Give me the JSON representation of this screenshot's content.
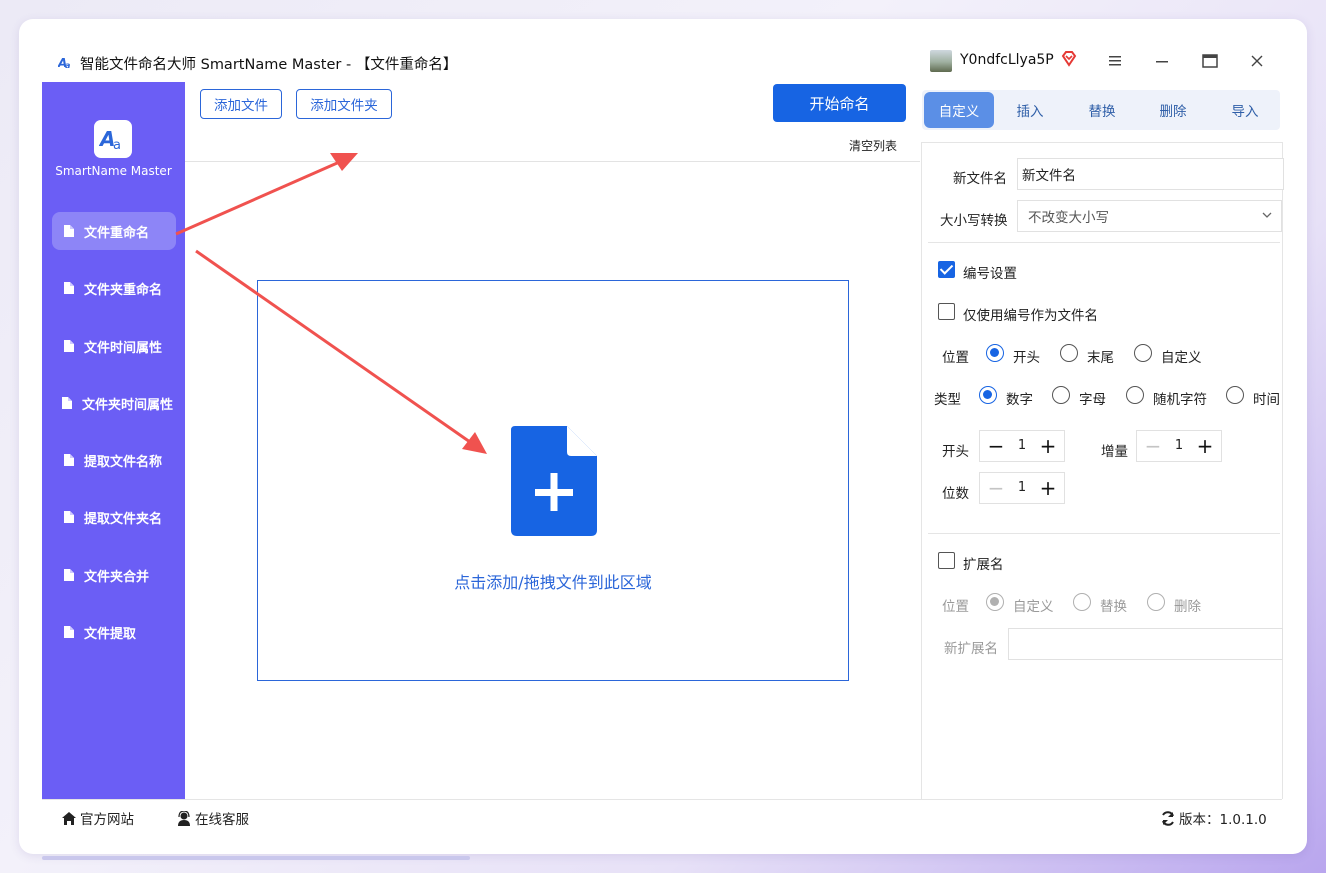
{
  "window": {
    "title": "智能文件命名大师 SmartName Master - 【文件重命名】",
    "username": "Y0ndfcLlya5P",
    "icons": {
      "menu": "hamburger-icon",
      "minimize": "minimize-icon",
      "maximize": "maximize-icon",
      "close": "close-icon",
      "vip": "vip-diamond-icon"
    }
  },
  "sidebar": {
    "app_name": "SmartName Master",
    "items": [
      {
        "label": "文件重命名",
        "active": true
      },
      {
        "label": "文件夹重命名",
        "active": false
      },
      {
        "label": "文件时间属性",
        "active": false
      },
      {
        "label": "文件夹时间属性",
        "active": false
      },
      {
        "label": "提取文件名称",
        "active": false
      },
      {
        "label": "提取文件夹名",
        "active": false
      },
      {
        "label": "文件夹合并",
        "active": false
      },
      {
        "label": "文件提取",
        "active": false
      }
    ]
  },
  "toolbar": {
    "add_file": "添加文件",
    "add_folder": "添加文件夹",
    "start_rename": "开始命名",
    "clear_list": "清空列表"
  },
  "dropzone": {
    "text": "点击添加/拖拽文件到此区域"
  },
  "tabs": [
    "自定义",
    "插入",
    "替换",
    "删除",
    "导入"
  ],
  "settings": {
    "new_name_label": "新文件名",
    "new_name_value": "新文件名",
    "case_label": "大小写转换",
    "case_value": "不改变大小写",
    "numbering_label": "编号设置",
    "numbering_checked": true,
    "only_number_label": "仅使用编号作为文件名",
    "only_number_checked": false,
    "position_label": "位置",
    "position_options": [
      "开头",
      "末尾",
      "自定义"
    ],
    "position_selected": "开头",
    "type_label": "类型",
    "type_options": [
      "数字",
      "字母",
      "随机字符",
      "时间"
    ],
    "type_selected": "数字",
    "start_label": "开头",
    "start_value": "1",
    "increment_label": "增量",
    "increment_value": "1",
    "digits_label": "位数",
    "digits_value": "1",
    "extension_label": "扩展名",
    "extension_checked": false,
    "ext_position_label": "位置",
    "ext_position_options": [
      "自定义",
      "替换",
      "删除"
    ],
    "ext_position_selected": "自定义",
    "new_ext_label": "新扩展名",
    "new_ext_value": ""
  },
  "footer": {
    "website": "官方网站",
    "support": "在线客服",
    "version": "版本：1.0.1.0"
  },
  "colors": {
    "sidebar": "#6b5ef5",
    "accent": "#1764e3",
    "annotation_arrow": "#f0524f"
  }
}
